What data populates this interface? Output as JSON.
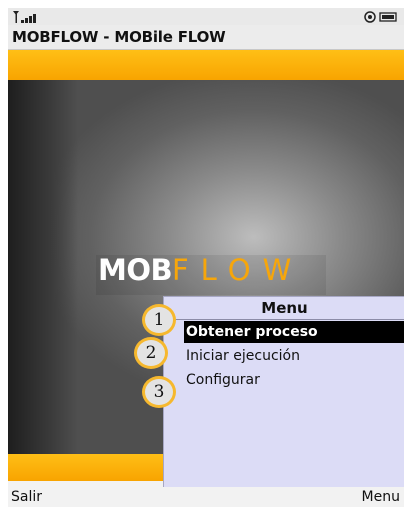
{
  "window": {
    "title": "MOBFLOW - MOBile FLOW"
  },
  "status_bar": {
    "signal_icon": "signal-antenna-icon",
    "right_icons": [
      "settings-icon",
      "battery-icon"
    ]
  },
  "splash": {
    "logo_part_1": "MOB",
    "logo_part_2": "FLOW",
    "logo_colors": {
      "mob": "#ffffff",
      "flow": "#f7a60a"
    }
  },
  "menu": {
    "title": "Menu",
    "items": [
      {
        "label": "Obtener proceso",
        "selected": true
      },
      {
        "label": "Iniciar ejecución",
        "selected": false
      },
      {
        "label": "Configurar",
        "selected": false
      }
    ]
  },
  "callouts": [
    "1",
    "2",
    "3"
  ],
  "softkeys": {
    "left": "Salir",
    "right": "Menu"
  },
  "colors": {
    "accent_orange": "#f8a400",
    "menu_background": "#dcdcf6",
    "selection": "#000000"
  }
}
